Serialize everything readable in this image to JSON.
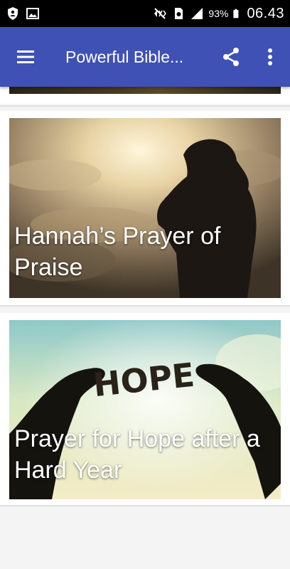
{
  "status_bar": {
    "battery_percent": "93%",
    "time": "06.43",
    "icons": [
      "shield-icon",
      "image-icon",
      "mute-icon",
      "sim-icon",
      "signal-icon",
      "battery-icon"
    ]
  },
  "app_bar": {
    "title": "Powerful Bible...",
    "background": "#3f51b5"
  },
  "cards": [
    {
      "title": "Hannah’s Prayer of Praise"
    },
    {
      "title": "Prayer for Hope after a Hard Year",
      "image_text": "HOPE"
    }
  ]
}
